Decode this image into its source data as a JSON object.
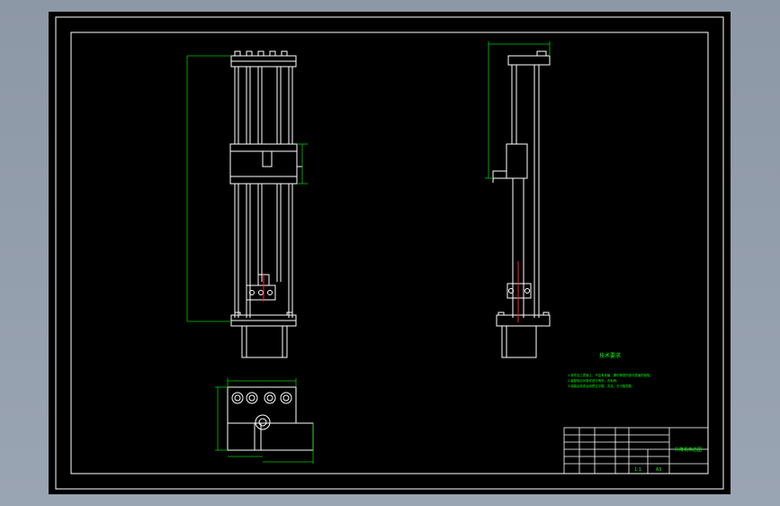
{
  "app": {
    "window_title": "",
    "colors": {
      "background": "#000000",
      "frame": "#ffffff",
      "dimension": "#00c800",
      "annotation": "#00ff00",
      "centerline": "#ff2020",
      "chrome": "#9aa5b3"
    }
  },
  "drawing": {
    "tech_notes": {
      "title": "技术要求",
      "lines": [
        "1.零件加工表面上，不应有划痕、擦伤等损伤零件表面的缺陷。",
        "2.装配前应对零件进行清洗，去毛刺。",
        "3.组装后检查运动是否平稳、灵活，无卡阻现象。"
      ]
    },
    "title_block": {
      "drawing_name": "升降机构总图",
      "scale": "1:1",
      "sheet": "A3"
    },
    "dimensions": {
      "front_height": "",
      "top_width": "",
      "side_width": ""
    }
  }
}
